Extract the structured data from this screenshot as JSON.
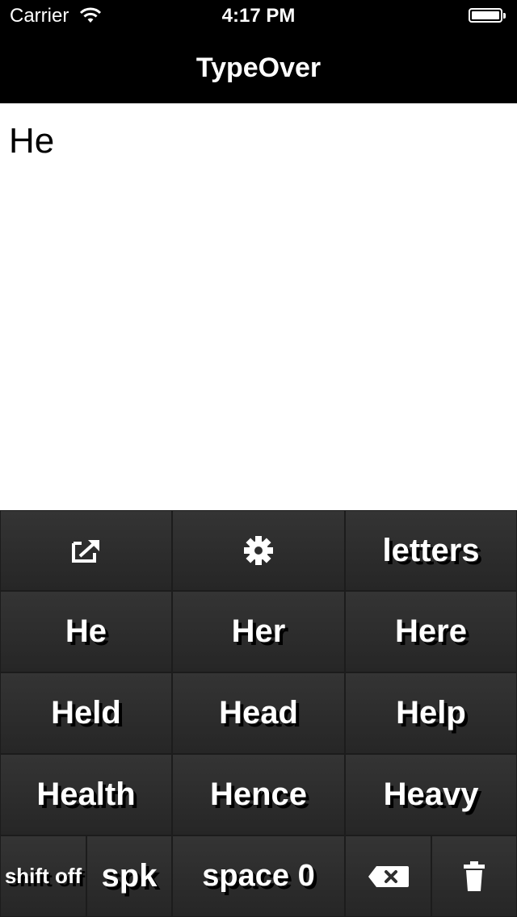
{
  "status_bar": {
    "carrier": "Carrier",
    "time": "4:17 PM"
  },
  "nav": {
    "title": "TypeOver"
  },
  "editor": {
    "text": "He"
  },
  "keyboard": {
    "toolbar": {
      "share_icon": "share-icon",
      "settings_icon": "gear-icon",
      "letters_label": "letters"
    },
    "suggestions": [
      [
        "He",
        "Her",
        "Here"
      ],
      [
        "Held",
        "Head",
        "Help"
      ],
      [
        "Health",
        "Hence",
        "Heavy"
      ]
    ],
    "bottom": {
      "shift_label": "shift off",
      "spk_label": "spk",
      "space_label": "space 0",
      "delete_icon": "backspace-icon",
      "trash_icon": "trash-icon"
    }
  },
  "colors": {
    "bar": "#000000",
    "keyboard_bg": "#2b2b2b",
    "key_text": "#ffffff"
  }
}
